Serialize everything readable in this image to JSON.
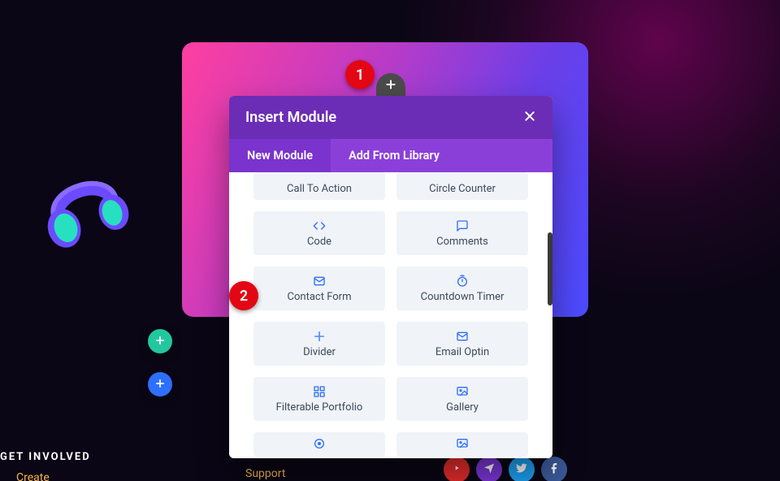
{
  "annotations": {
    "one": "1",
    "two": "2"
  },
  "modal": {
    "title": "Insert Module",
    "tabs": {
      "new": "New Module",
      "library": "Add From Library"
    }
  },
  "modules": {
    "call_to_action": "Call To Action",
    "circle_counter": "Circle Counter",
    "code": "Code",
    "comments": "Comments",
    "contact_form": "Contact Form",
    "countdown_timer": "Countdown Timer",
    "divider": "Divider",
    "email_optin": "Email Optin",
    "filterable_portfolio": "Filterable Portfolio",
    "gallery": "Gallery"
  },
  "footer": {
    "heading": "GET INVOLVED",
    "link_create": "Create",
    "link_support": "Support"
  }
}
